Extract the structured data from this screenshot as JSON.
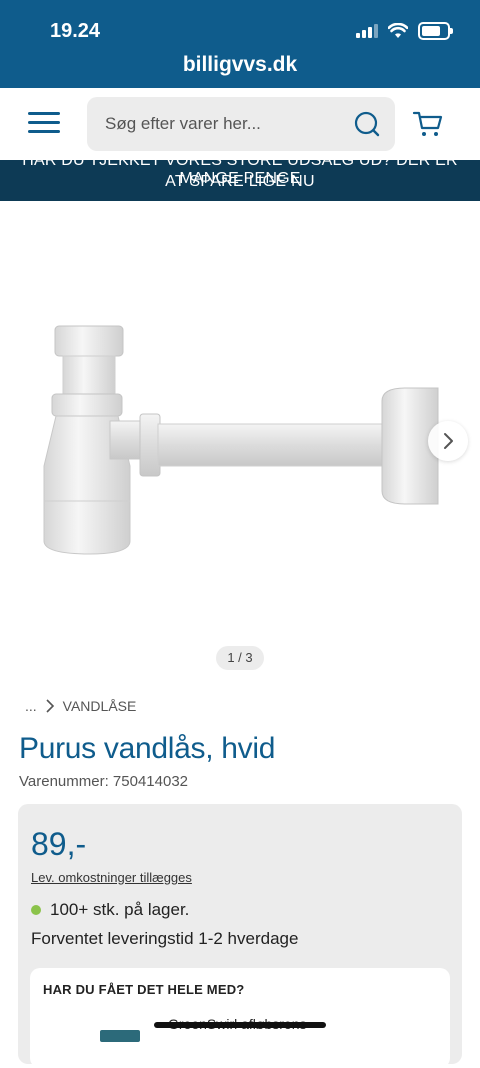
{
  "status_bar": {
    "time": "19.24",
    "url": "billigvvs.dk"
  },
  "header": {
    "search_placeholder": "Søg efter varer her...",
    "menu_icon": "hamburger-menu-icon",
    "search_icon": "search-icon",
    "cart_icon": "cart-icon"
  },
  "banner": {
    "line1": "HAR DU TJEKKET VORES STORE UDSALG UD? DER ER MANGE PENGE",
    "line2": "AT SPARE LIGE NU"
  },
  "gallery": {
    "pager": "1 / 3"
  },
  "breadcrumb": {
    "ellipsis": "...",
    "category": "VANDLÅSE"
  },
  "product": {
    "title": "Purus vandlås, hvid",
    "sku": "Varenummer: 750414032",
    "price": "89,-",
    "fees_link": "Lev. omkostninger tillægges",
    "stock": "100+ stk. på lager.",
    "delivery": "Forventet leveringstid 1-2 hverdage"
  },
  "addon": {
    "title": "HAR DU FÅET DET HELE MED?",
    "item_name": "GreenSwirl afløbsrens"
  },
  "colors": {
    "brand_blue": "#0f5c8c",
    "banner_navy": "#0d3a55",
    "stock_green": "#8bc34a"
  }
}
